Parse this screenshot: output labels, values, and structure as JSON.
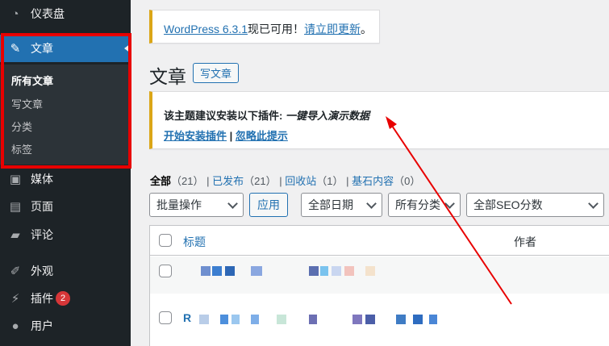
{
  "sidebar": {
    "items": [
      {
        "label": "仪表盘",
        "icon": "dashboard-icon",
        "glyph": "◔"
      },
      {
        "label": "文章",
        "icon": "pushpin-icon",
        "glyph": "✎"
      },
      {
        "label": "媒体",
        "icon": "media-icon",
        "glyph": "▣"
      },
      {
        "label": "页面",
        "icon": "pages-icon",
        "glyph": "▤"
      },
      {
        "label": "评论",
        "icon": "comments-icon",
        "glyph": "▰"
      },
      {
        "label": "外观",
        "icon": "appearance-icon",
        "glyph": "✐"
      },
      {
        "label": "插件",
        "icon": "plugins-icon",
        "glyph": "⚡",
        "badge": "2"
      },
      {
        "label": "用户",
        "icon": "users-icon",
        "glyph": "●"
      }
    ],
    "submenu": [
      "所有文章",
      "写文章",
      "分类",
      "标签"
    ]
  },
  "notices": {
    "update_link": "WordPress 6.3.1",
    "update_text": "现已可用！",
    "update_action": "请立即更新",
    "update_end": "。",
    "plugin_prefix": "该主题建议安装以下插件: ",
    "plugin_name": "一键导入演示数据",
    "plugin_install": "开始安装插件",
    "plugin_sep": " | ",
    "plugin_dismiss": "忽略此提示"
  },
  "page": {
    "title": "文章",
    "add_new": "写文章"
  },
  "views": {
    "all": "全部",
    "all_count": "（21）",
    "sep": "|",
    "published": "已发布",
    "published_count": "（21）",
    "trash": "回收站",
    "trash_count": "（1）",
    "cornerstone": "基石内容",
    "cornerstone_count": "（0）"
  },
  "filters": {
    "bulk": "批量操作",
    "apply": "应用",
    "dates": "全部日期",
    "categories": "所有分类",
    "seo": "全部SEO分数"
  },
  "table": {
    "col_title": "标题",
    "col_author": "作者",
    "row2_prefix": "R"
  },
  "colors": {
    "accent": "#2271b1",
    "annotation": "#e80000",
    "sidebar": "#1d2327"
  }
}
